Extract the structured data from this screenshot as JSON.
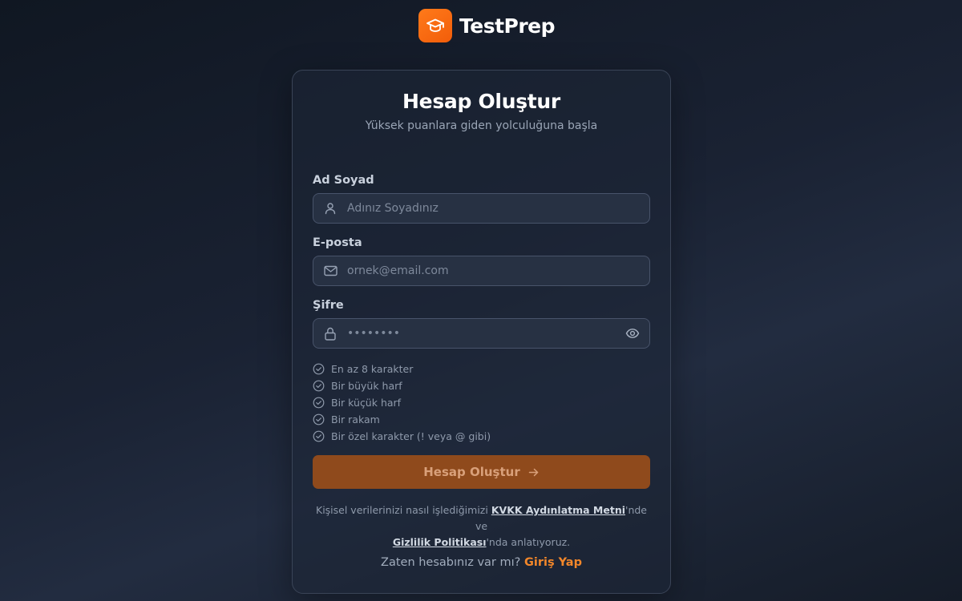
{
  "brand": {
    "name": "TestPrep",
    "logo_icon": "graduation-cap-icon",
    "accent": "#f26b0f"
  },
  "form": {
    "title": "Hesap Oluştur",
    "subtitle": "Yüksek puanlara giden yolculuğuna başla",
    "name_field": {
      "label": "Ad Soyad",
      "placeholder": "Adınız Soyadınız",
      "value": "",
      "icon": "user-icon"
    },
    "email_field": {
      "label": "E-posta",
      "placeholder": "ornek@email.com",
      "value": "",
      "icon": "mail-icon"
    },
    "password_field": {
      "label": "Şifre",
      "placeholder": "••••••••",
      "value": "",
      "icon": "lock-icon",
      "toggle_icon": "eye-icon"
    },
    "password_requirements": [
      "En az 8 karakter",
      "Bir büyük harf",
      "Bir küçük harf",
      "Bir rakam",
      "Bir özel karakter (! veya @ gibi)"
    ],
    "submit_label": "Hesap Oluştur",
    "legal": {
      "prefix": "Kişisel verilerinizi nasıl işlediğimizi ",
      "kvkk_link": "KVKK Aydınlatma Metni",
      "middle": "'nde ve",
      "privacy_link": "Gizlilik Politikası",
      "suffix": "'nda anlatıyoruz."
    },
    "login_prompt": "Zaten hesabınız var mı?",
    "login_link": "Giriş Yap"
  }
}
